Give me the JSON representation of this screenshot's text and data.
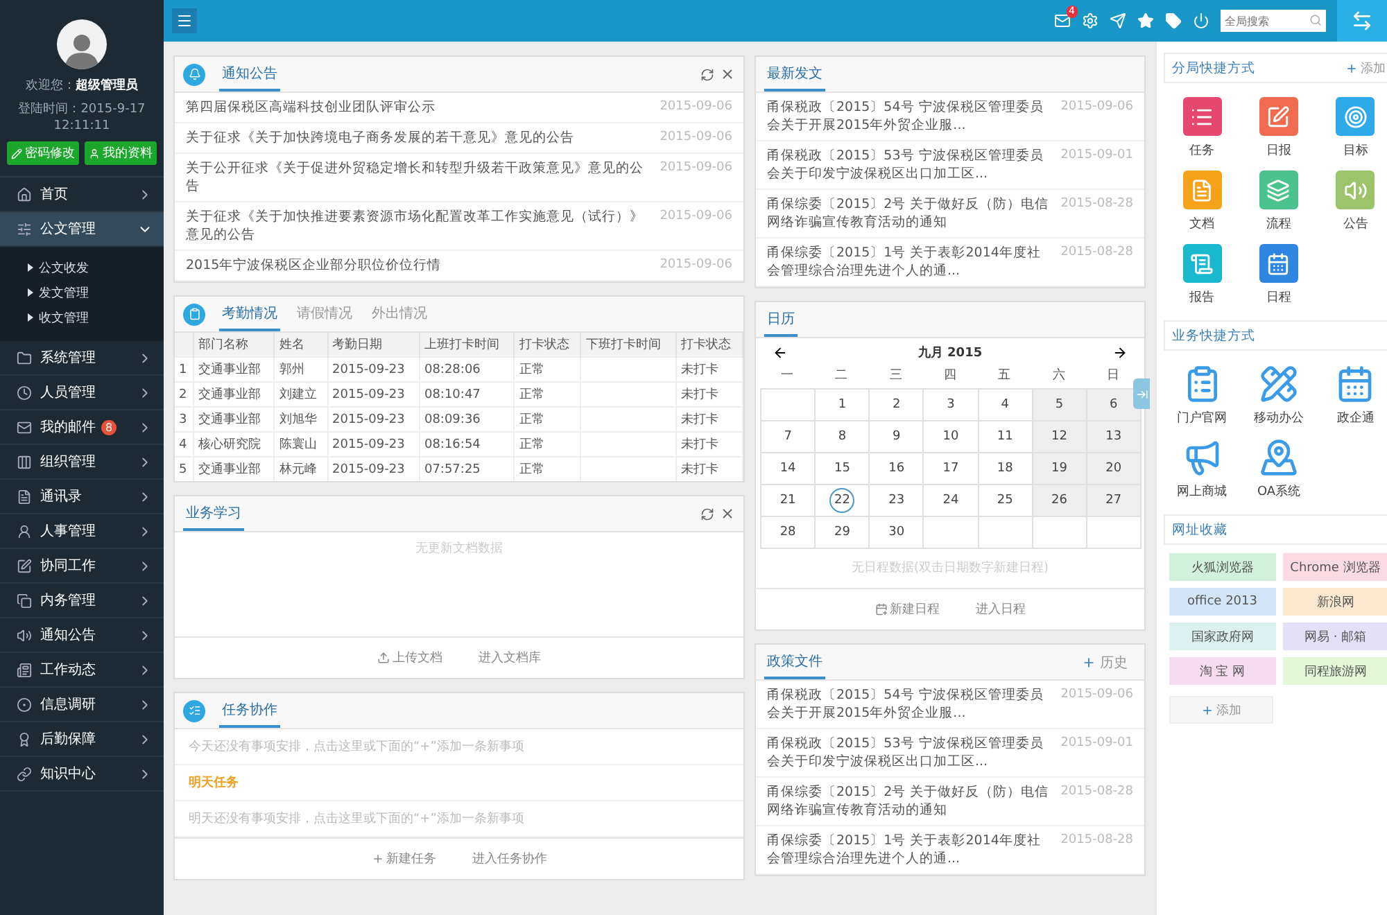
{
  "topbar": {
    "mail_badge": "4",
    "search": {
      "placeholder": "全局搜索"
    }
  },
  "sidebar": {
    "welcome": "欢迎您：",
    "user": "超级管理员",
    "login_time": "登陆时间：2015-9-17 12:11:11",
    "buttons": [
      "密码修改",
      "我的资料"
    ],
    "items": [
      {
        "label": "首页",
        "selected": false,
        "expanded": false
      },
      {
        "label": "公文管理",
        "selected": true,
        "expanded": true,
        "children": [
          {
            "label": "公文收发"
          },
          {
            "label": "发文管理"
          },
          {
            "label": "收文管理"
          }
        ]
      },
      {
        "label": "系统管理",
        "selected": false,
        "expanded": false
      },
      {
        "label": "人员管理",
        "selected": false,
        "expanded": false
      },
      {
        "label": "我的邮件",
        "selected": false,
        "expanded": false,
        "badge": "8"
      },
      {
        "label": "组织管理",
        "selected": false,
        "expanded": false
      },
      {
        "label": "通讯录",
        "selected": false,
        "expanded": false
      },
      {
        "label": "人事管理",
        "selected": false,
        "expanded": false
      },
      {
        "label": "协同工作",
        "selected": false,
        "expanded": false
      },
      {
        "label": "内务管理",
        "selected": false,
        "expanded": false
      },
      {
        "label": "通知公告",
        "selected": false,
        "expanded": false
      },
      {
        "label": "工作动态",
        "selected": false,
        "expanded": false
      },
      {
        "label": "信息调研",
        "selected": false,
        "expanded": false
      },
      {
        "label": "后勤保障",
        "selected": false,
        "expanded": false
      },
      {
        "label": "知识中心",
        "selected": false,
        "expanded": false
      }
    ]
  },
  "notices": {
    "title": "通知公告",
    "tools": true,
    "rows": [
      {
        "text": "第四届保税区高端科技创业团队评审公示",
        "date": "2015-09-06"
      },
      {
        "text": "关于征求《关于加快跨境电子商务发展的若干意见》意见的公告",
        "date": "2015-09-06"
      },
      {
        "text": "关于公开征求《关于促进外贸稳定增长和转型升级若干政策意见》意见的公告",
        "date": "2015-09-06"
      },
      {
        "text": "关于征求《关于加快推进要素资源市场化配置改革工作实施意见（试行）》意见的公告",
        "date": "2015-09-06"
      },
      {
        "text": "2015年宁波保税区企业部分职位价位行情",
        "date": "2015-09-06"
      }
    ]
  },
  "attendance": {
    "tabs": [
      {
        "label": "考勤情况",
        "selected": true
      },
      {
        "label": "请假情况",
        "selected": false
      },
      {
        "label": "外出情况",
        "selected": false
      }
    ],
    "columns": [
      "",
      "部门名称",
      "姓名",
      "考勤日期",
      "上班打卡时间",
      "打卡状态",
      "下班打卡时间",
      "打卡状态"
    ],
    "rows": [
      [
        "1",
        "交通事业部",
        "郭州",
        "2015-09-23",
        "08:28:06",
        "正常",
        null,
        "未打卡"
      ],
      [
        "2",
        "交通事业部",
        "刘建立",
        "2015-09-23",
        "08:10:47",
        "正常",
        null,
        "未打卡"
      ],
      [
        "3",
        "交通事业部",
        "刘旭华",
        "2015-09-23",
        "08:09:36",
        "正常",
        null,
        "未打卡"
      ],
      [
        "4",
        "核心研究院",
        "陈寰山",
        "2015-09-23",
        "08:16:54",
        "正常",
        null,
        "未打卡"
      ],
      [
        "5",
        "交通事业部",
        "林元峰",
        "2015-09-23",
        "07:57:25",
        "正常",
        null,
        "未打卡"
      ]
    ]
  },
  "study": {
    "title": "业务学习",
    "tools": true,
    "empty": "无更新文档数据",
    "actions": [
      "上传文档",
      "进入文档库"
    ]
  },
  "tasks": {
    "title": "任务协作",
    "tools": false,
    "lines": [
      {
        "kind": "note",
        "text": "今天还没有事项安排，点击这里或下面的“+”添加一条新事项"
      },
      {
        "kind": "heading",
        "text": "明天任务"
      },
      {
        "kind": "note",
        "text": "明天还没有事项安排，点击这里或下面的“+”添加一条新事项"
      }
    ],
    "actions": [
      "新建任务",
      "进入任务协作"
    ]
  },
  "latest_docs": {
    "title": "最新发文",
    "rows": [
      {
        "text": "甬保税政〔2015〕54号 宁波保税区管理委员会关于开展2015年外贸企业服...",
        "date": "2015-09-06"
      },
      {
        "text": "甬保税政〔2015〕53号 宁波保税区管理委员会关于印发宁波保税区出口加工区...",
        "date": "2015-09-01"
      },
      {
        "text": "甬保综委〔2015〕2号 关于做好反（防）电信网络诈骗宣传教育活动的通知",
        "date": "2015-08-28"
      },
      {
        "text": "甬保综委〔2015〕1号 关于表彰2014年度社会管理综合治理先进个人的通...",
        "date": "2015-08-28"
      }
    ]
  },
  "calendar": {
    "title": "日历",
    "month": "九月 2015",
    "weekdays": [
      "一",
      "二",
      "三",
      "四",
      "五",
      "六",
      "日"
    ],
    "weeks": [
      [
        {
          "d": "1",
          "today": false
        },
        {
          "d": "2",
          "today": false
        },
        {
          "d": "3",
          "today": false
        },
        {
          "d": "4",
          "today": false
        },
        {
          "d": "5",
          "today": false
        },
        {
          "d": "6",
          "today": false
        }
      ],
      [
        {
          "d": "7",
          "today": false
        },
        {
          "d": "8",
          "today": false
        },
        {
          "d": "9",
          "today": false
        },
        {
          "d": "10",
          "today": false
        },
        {
          "d": "11",
          "today": false
        },
        {
          "d": "12",
          "today": false
        },
        {
          "d": "13",
          "today": false
        }
      ],
      [
        {
          "d": "14",
          "today": false
        },
        {
          "d": "15",
          "today": false
        },
        {
          "d": "16",
          "today": false
        },
        {
          "d": "17",
          "today": false
        },
        {
          "d": "18",
          "today": false
        },
        {
          "d": "19",
          "today": false
        },
        {
          "d": "20",
          "today": false
        }
      ],
      [
        {
          "d": "21",
          "today": false
        },
        {
          "d": "22",
          "today": true
        },
        {
          "d": "23",
          "today": false
        },
        {
          "d": "24",
          "today": false
        },
        {
          "d": "25",
          "today": false
        },
        {
          "d": "26",
          "today": false
        },
        {
          "d": "27",
          "today": false
        }
      ],
      [
        {
          "d": "28",
          "today": false
        },
        {
          "d": "29",
          "today": false
        },
        {
          "d": "30",
          "today": false
        }
      ]
    ],
    "note": "无日程数据(双击日期数字新建日程)",
    "actions": [
      "新建日程",
      "进入日程"
    ]
  },
  "policy_docs": {
    "title": "政策文件",
    "action": "历史",
    "rows": [
      {
        "text": "甬保税政〔2015〕54号 宁波保税区管理委员会关于开展2015年外贸企业服...",
        "date": "2015-09-06"
      },
      {
        "text": "甬保税政〔2015〕53号 宁波保税区管理委员会关于印发宁波保税区出口加工区...",
        "date": "2015-09-01"
      },
      {
        "text": "甬保综委〔2015〕2号 关于做好反（防）电信网络诈骗宣传教育活动的通知",
        "date": "2015-08-28"
      },
      {
        "text": "甬保综委〔2015〕1号 关于表彰2014年度社会管理综合治理先进个人的通...",
        "date": "2015-08-28"
      }
    ]
  },
  "right_panel": {
    "branch_shortcuts": {
      "title": "分局快捷方式",
      "action": "添加",
      "items": [
        {
          "label": "任务",
          "color": "#e5486f"
        },
        {
          "label": "日报",
          "color": "#f06b4f"
        },
        {
          "label": "目标",
          "color": "#2ea9ea"
        },
        {
          "label": "文档",
          "color": "#f7a21b"
        },
        {
          "label": "流程",
          "color": "#4cc38f"
        },
        {
          "label": "公告",
          "color": "#9dc36b"
        },
        {
          "label": "报告",
          "color": "#1bb9cf"
        },
        {
          "label": "日程",
          "color": "#2f86e0"
        }
      ]
    },
    "business_shortcuts": {
      "title": "业务快捷方式",
      "items": [
        {
          "label": "门户官网"
        },
        {
          "label": "移动办公"
        },
        {
          "label": "政企通"
        },
        {
          "label": "网上商城"
        },
        {
          "label": "OA系统"
        }
      ]
    },
    "bookmarks": {
      "title": "网址收藏",
      "items": [
        {
          "label": "火狐浏览器",
          "color": "#d3f0dc"
        },
        {
          "label": "Chrome 浏览器",
          "color": "#fadbe3"
        },
        {
          "label": "office 2013",
          "color": "#d3e5f6"
        },
        {
          "label": "新浪网",
          "color": "#fbe9cf"
        },
        {
          "label": "国家政府网",
          "color": "#dcf0f0"
        },
        {
          "label": "网易 · 邮箱",
          "color": "#e4e1f6"
        },
        {
          "label": "淘 宝 网",
          "color": "#f5dcf0"
        },
        {
          "label": "同程旅游网",
          "color": "#e3f7d8"
        }
      ],
      "add": "添加"
    }
  }
}
